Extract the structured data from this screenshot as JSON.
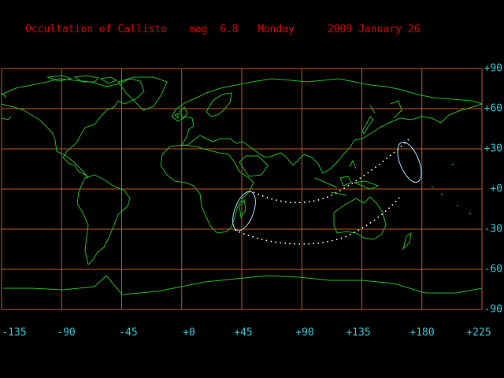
{
  "header": {
    "event": "Occultation of Callisto",
    "magnitude": "mag  6.8",
    "weekday": "Monday",
    "date": "2009 January 26"
  },
  "map": {
    "lon_ticks": [
      "-135",
      "-90",
      "-45",
      "+0",
      "+45",
      "+90",
      "+135",
      "+180",
      "+225"
    ],
    "lat_ticks": [
      "+90",
      "+60",
      "+30",
      "+0",
      "-30",
      "-60",
      "-90"
    ],
    "colors": {
      "background": "#000000",
      "grid": "#c0581c",
      "coastline": "#22b822",
      "occultation_path": "#ffffff",
      "limit_curve": "#a0e0ff",
      "title": "#d40000",
      "axis_labels": "#33c8d8"
    }
  }
}
